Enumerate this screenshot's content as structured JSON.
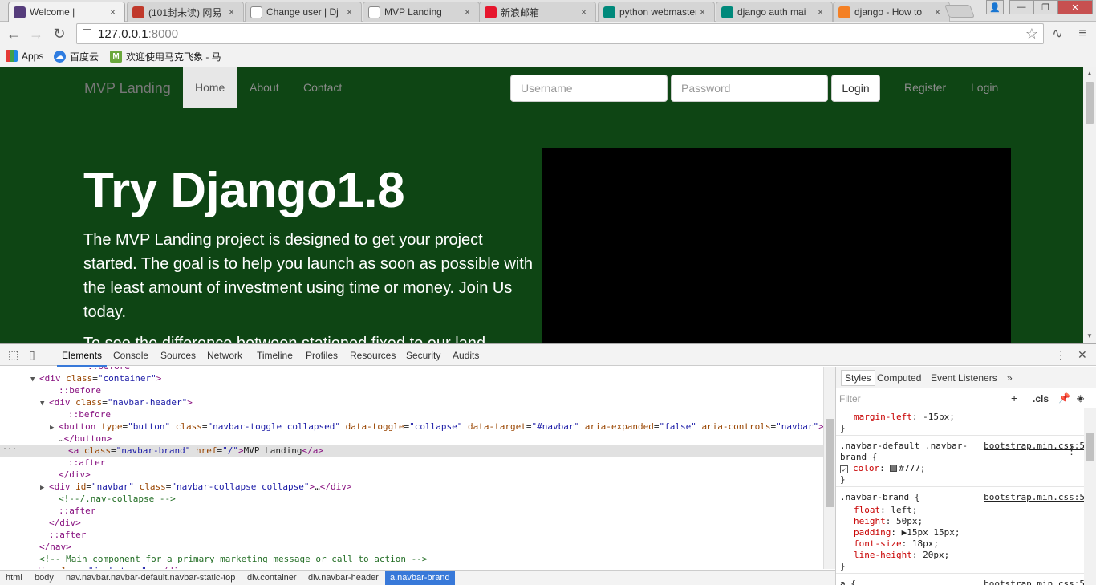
{
  "browser": {
    "tabs": [
      {
        "label": "Welcome |",
        "icon": "bootstrap-icon",
        "color": "#563d7c"
      },
      {
        "label": "(101封未读) 网易",
        "icon": "netease-mail-icon",
        "color": "#c0392b"
      },
      {
        "label": "Change user | Dj",
        "icon": "page-icon",
        "color": "#ffffff"
      },
      {
        "label": "MVP Landing",
        "icon": "page-icon",
        "color": "#ffffff"
      },
      {
        "label": "新浪邮箱",
        "icon": "sina-weibo-icon",
        "color": "#e6162d"
      },
      {
        "label": "python webmaster",
        "icon": "bing-icon",
        "color": "#00897b"
      },
      {
        "label": "django auth mai",
        "icon": "bing-icon",
        "color": "#00897b"
      },
      {
        "label": "django - How to",
        "icon": "stackoverflow-icon",
        "color": "#f48024"
      }
    ],
    "address": {
      "host": "127.0.0.1",
      "port": ":8000"
    },
    "bookmarks": [
      {
        "label": "Apps",
        "icon": "apps-grid-icon"
      },
      {
        "label": "百度云",
        "icon": "baidu-cloud-icon"
      },
      {
        "label": "欢迎使用马克飞象 - 马",
        "icon": "maxiang-icon"
      }
    ]
  },
  "page": {
    "brand": "MVP Landing",
    "nav": [
      {
        "label": "Home",
        "active": true
      },
      {
        "label": "About",
        "active": false
      },
      {
        "label": "Contact",
        "active": false
      }
    ],
    "username_placeholder": "Username",
    "password_placeholder": "Password",
    "login_button": "Login",
    "right_links": [
      "Register",
      "Login"
    ],
    "title": "Try Django1.8",
    "lead": "The MVP Landing project is designed to get your project started. The goal is to help you launch as soon as possible with the least amount of investment using time or money. Join Us today.",
    "cut_text": "To see the difference between stationed fixed to our land",
    "colors": {
      "background": "#0e4514",
      "video": "#000000"
    }
  },
  "devtools": {
    "tabs": [
      "Elements",
      "Console",
      "Sources",
      "Network",
      "Timeline",
      "Profiles",
      "Resources",
      "Security",
      "Audits"
    ],
    "active_tab": "Elements",
    "dom_lines": [
      {
        "indent": 8,
        "tri": "",
        "html": "<span class='pseudo'>::before</span>"
      },
      {
        "indent": 3,
        "tri": "▼",
        "html": "<span class='tag'>&lt;div</span> <span class='attr'>class</span>=<span class='val'>\"container\"</span><span class='tag'>&gt;</span>"
      },
      {
        "indent": 5,
        "tri": "",
        "html": "<span class='pseudo'>::before</span>"
      },
      {
        "indent": 4,
        "tri": "▼",
        "html": "<span class='tag'>&lt;div</span> <span class='attr'>class</span>=<span class='val'>\"navbar-header\"</span><span class='tag'>&gt;</span>"
      },
      {
        "indent": 6,
        "tri": "",
        "html": "<span class='pseudo'>::before</span>"
      },
      {
        "indent": 5,
        "tri": "▶",
        "html": "<span class='tag'>&lt;button</span> <span class='attr'>type</span>=<span class='val'>\"button\"</span> <span class='attr'>class</span>=<span class='val'>\"navbar-toggle collapsed\"</span> <span class='attr'>data-toggle</span>=<span class='val'>\"collapse\"</span> <span class='attr'>data-target</span>=<span class='val'>\"#navbar\"</span> <span class='attr'>aria-expanded</span>=<span class='val'>\"false\"</span> <span class='attr'>aria-controls</span>=<span class='val'>\"navbar\"</span><span class='tag'>&gt;</span>"
      },
      {
        "indent": 5,
        "tri": "",
        "html": "…<span class='tag'>&lt;/button&gt;</span>"
      },
      {
        "indent": 6,
        "tri": "",
        "sel": true,
        "html": "<span class='tag'>&lt;a</span> <span class='attr'>class</span>=<span class='val'>\"navbar-brand\"</span> <span class='attr'>href</span>=<span class='val'>\"/\"</span><span class='tag'>&gt;</span>MVP Landing<span class='tag'>&lt;/a&gt;</span>"
      },
      {
        "indent": 6,
        "tri": "",
        "html": "<span class='pseudo'>::after</span>"
      },
      {
        "indent": 5,
        "tri": "",
        "html": "<span class='tag'>&lt;/div&gt;</span>"
      },
      {
        "indent": 4,
        "tri": "▶",
        "html": "<span class='tag'>&lt;div</span> <span class='attr'>id</span>=<span class='val'>\"navbar\"</span> <span class='attr'>class</span>=<span class='val'>\"navbar-collapse collapse\"</span><span class='tag'>&gt;</span>…<span class='tag'>&lt;/div&gt;</span>"
      },
      {
        "indent": 5,
        "tri": "",
        "html": "<span class='comment'>&lt;!--/.nav-collapse --&gt;</span>"
      },
      {
        "indent": 5,
        "tri": "",
        "html": "<span class='pseudo'>::after</span>"
      },
      {
        "indent": 4,
        "tri": "",
        "html": "<span class='tag'>&lt;/div&gt;</span>"
      },
      {
        "indent": 4,
        "tri": "",
        "html": "<span class='pseudo'>::after</span>"
      },
      {
        "indent": 3,
        "tri": "",
        "html": "<span class='tag'>&lt;/nav&gt;</span>"
      },
      {
        "indent": 3,
        "tri": "",
        "html": "<span class='comment'>&lt;!-- Main component for a primary marketing message or call to action --&gt;</span>"
      },
      {
        "indent": 2,
        "tri": "▶",
        "html": "<span class='tag'>&lt;div</span> <span class='attr'>class</span>=<span class='val'>\"jumbotron\"</span><span class='tag'>&gt;</span>…<span class='tag'>&lt;/div&gt;</span>"
      }
    ],
    "breadcrumbs": [
      "html",
      "body",
      "nav.navbar.navbar-default.navbar-static-top",
      "div.container",
      "div.navbar-header",
      "a.navbar-brand"
    ],
    "styles_tabs": [
      "Styles",
      "Computed",
      "Event Listeners"
    ],
    "filter_placeholder": "Filter",
    "cls_label": ".cls",
    "rules": [
      {
        "selector": "",
        "source": "",
        "props": [
          {
            "name": "margin-left",
            "value": "-15px"
          }
        ]
      },
      {
        "selector": ".navbar-default .navbar-brand {",
        "source": "bootstrap.min.css:5",
        "props": [
          {
            "name": "color",
            "value": "#777",
            "swatch": true,
            "checked": true
          }
        ]
      },
      {
        "selector": ".navbar-brand {",
        "source": "bootstrap.min.css:5",
        "props": [
          {
            "name": "float",
            "value": "left"
          },
          {
            "name": "height",
            "value": "50px"
          },
          {
            "name": "padding",
            "value": "▶15px 15px"
          },
          {
            "name": "font-size",
            "value": "18px"
          },
          {
            "name": "line-height",
            "value": "20px"
          }
        ]
      },
      {
        "selector": "a {",
        "source": "bootstrap.min.css:5",
        "props": []
      }
    ]
  }
}
